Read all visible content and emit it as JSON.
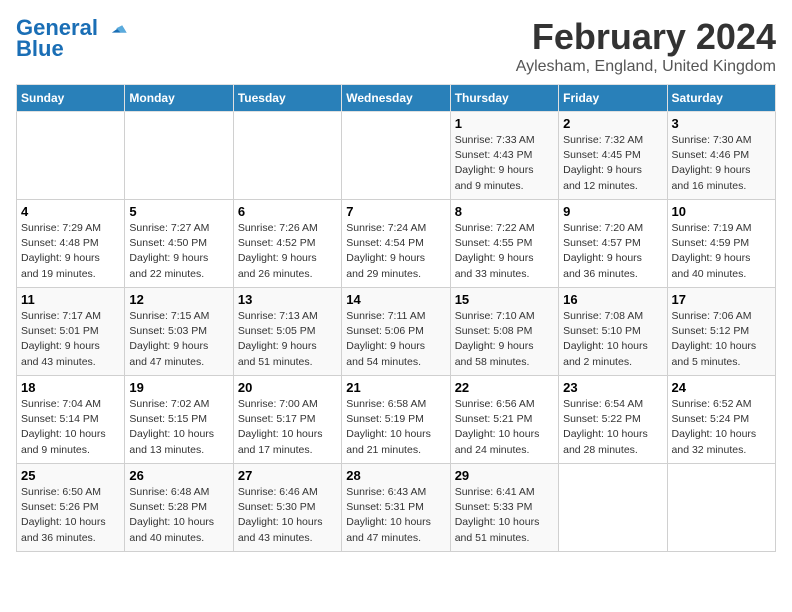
{
  "header": {
    "logo_line1": "General",
    "logo_line2": "Blue",
    "month": "February 2024",
    "location": "Aylesham, England, United Kingdom"
  },
  "days_of_week": [
    "Sunday",
    "Monday",
    "Tuesday",
    "Wednesday",
    "Thursday",
    "Friday",
    "Saturday"
  ],
  "weeks": [
    [
      {
        "day": "",
        "info": ""
      },
      {
        "day": "",
        "info": ""
      },
      {
        "day": "",
        "info": ""
      },
      {
        "day": "",
        "info": ""
      },
      {
        "day": "1",
        "info": "Sunrise: 7:33 AM\nSunset: 4:43 PM\nDaylight: 9 hours\nand 9 minutes."
      },
      {
        "day": "2",
        "info": "Sunrise: 7:32 AM\nSunset: 4:45 PM\nDaylight: 9 hours\nand 12 minutes."
      },
      {
        "day": "3",
        "info": "Sunrise: 7:30 AM\nSunset: 4:46 PM\nDaylight: 9 hours\nand 16 minutes."
      }
    ],
    [
      {
        "day": "4",
        "info": "Sunrise: 7:29 AM\nSunset: 4:48 PM\nDaylight: 9 hours\nand 19 minutes."
      },
      {
        "day": "5",
        "info": "Sunrise: 7:27 AM\nSunset: 4:50 PM\nDaylight: 9 hours\nand 22 minutes."
      },
      {
        "day": "6",
        "info": "Sunrise: 7:26 AM\nSunset: 4:52 PM\nDaylight: 9 hours\nand 26 minutes."
      },
      {
        "day": "7",
        "info": "Sunrise: 7:24 AM\nSunset: 4:54 PM\nDaylight: 9 hours\nand 29 minutes."
      },
      {
        "day": "8",
        "info": "Sunrise: 7:22 AM\nSunset: 4:55 PM\nDaylight: 9 hours\nand 33 minutes."
      },
      {
        "day": "9",
        "info": "Sunrise: 7:20 AM\nSunset: 4:57 PM\nDaylight: 9 hours\nand 36 minutes."
      },
      {
        "day": "10",
        "info": "Sunrise: 7:19 AM\nSunset: 4:59 PM\nDaylight: 9 hours\nand 40 minutes."
      }
    ],
    [
      {
        "day": "11",
        "info": "Sunrise: 7:17 AM\nSunset: 5:01 PM\nDaylight: 9 hours\nand 43 minutes."
      },
      {
        "day": "12",
        "info": "Sunrise: 7:15 AM\nSunset: 5:03 PM\nDaylight: 9 hours\nand 47 minutes."
      },
      {
        "day": "13",
        "info": "Sunrise: 7:13 AM\nSunset: 5:05 PM\nDaylight: 9 hours\nand 51 minutes."
      },
      {
        "day": "14",
        "info": "Sunrise: 7:11 AM\nSunset: 5:06 PM\nDaylight: 9 hours\nand 54 minutes."
      },
      {
        "day": "15",
        "info": "Sunrise: 7:10 AM\nSunset: 5:08 PM\nDaylight: 9 hours\nand 58 minutes."
      },
      {
        "day": "16",
        "info": "Sunrise: 7:08 AM\nSunset: 5:10 PM\nDaylight: 10 hours\nand 2 minutes."
      },
      {
        "day": "17",
        "info": "Sunrise: 7:06 AM\nSunset: 5:12 PM\nDaylight: 10 hours\nand 5 minutes."
      }
    ],
    [
      {
        "day": "18",
        "info": "Sunrise: 7:04 AM\nSunset: 5:14 PM\nDaylight: 10 hours\nand 9 minutes."
      },
      {
        "day": "19",
        "info": "Sunrise: 7:02 AM\nSunset: 5:15 PM\nDaylight: 10 hours\nand 13 minutes."
      },
      {
        "day": "20",
        "info": "Sunrise: 7:00 AM\nSunset: 5:17 PM\nDaylight: 10 hours\nand 17 minutes."
      },
      {
        "day": "21",
        "info": "Sunrise: 6:58 AM\nSunset: 5:19 PM\nDaylight: 10 hours\nand 21 minutes."
      },
      {
        "day": "22",
        "info": "Sunrise: 6:56 AM\nSunset: 5:21 PM\nDaylight: 10 hours\nand 24 minutes."
      },
      {
        "day": "23",
        "info": "Sunrise: 6:54 AM\nSunset: 5:22 PM\nDaylight: 10 hours\nand 28 minutes."
      },
      {
        "day": "24",
        "info": "Sunrise: 6:52 AM\nSunset: 5:24 PM\nDaylight: 10 hours\nand 32 minutes."
      }
    ],
    [
      {
        "day": "25",
        "info": "Sunrise: 6:50 AM\nSunset: 5:26 PM\nDaylight: 10 hours\nand 36 minutes."
      },
      {
        "day": "26",
        "info": "Sunrise: 6:48 AM\nSunset: 5:28 PM\nDaylight: 10 hours\nand 40 minutes."
      },
      {
        "day": "27",
        "info": "Sunrise: 6:46 AM\nSunset: 5:30 PM\nDaylight: 10 hours\nand 43 minutes."
      },
      {
        "day": "28",
        "info": "Sunrise: 6:43 AM\nSunset: 5:31 PM\nDaylight: 10 hours\nand 47 minutes."
      },
      {
        "day": "29",
        "info": "Sunrise: 6:41 AM\nSunset: 5:33 PM\nDaylight: 10 hours\nand 51 minutes."
      },
      {
        "day": "",
        "info": ""
      },
      {
        "day": "",
        "info": ""
      }
    ]
  ]
}
